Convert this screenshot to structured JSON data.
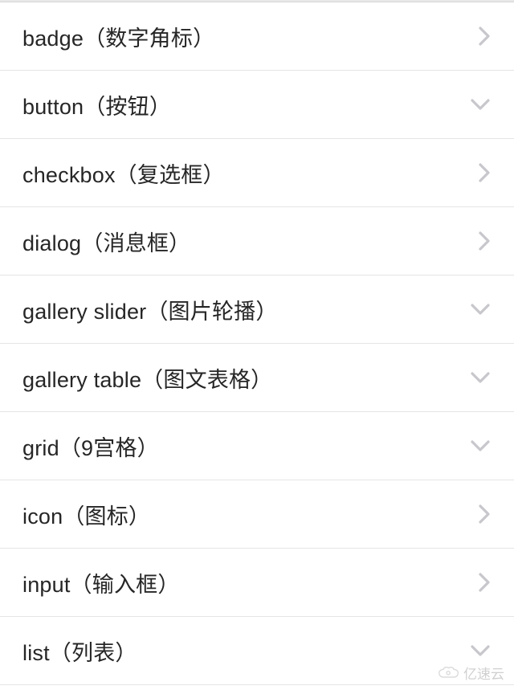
{
  "list": {
    "items": [
      {
        "label": "badge（数字角标）",
        "expandable": false
      },
      {
        "label": "button（按钮）",
        "expandable": true
      },
      {
        "label": "checkbox（复选框）",
        "expandable": false
      },
      {
        "label": "dialog（消息框）",
        "expandable": false
      },
      {
        "label": "gallery slider（图片轮播）",
        "expandable": true
      },
      {
        "label": "gallery table（图文表格）",
        "expandable": true
      },
      {
        "label": "grid（9宫格）",
        "expandable": true
      },
      {
        "label": "icon（图标）",
        "expandable": false
      },
      {
        "label": "input（输入框）",
        "expandable": false
      },
      {
        "label": "list（列表）",
        "expandable": true
      }
    ]
  },
  "watermark": {
    "text": "亿速云"
  }
}
